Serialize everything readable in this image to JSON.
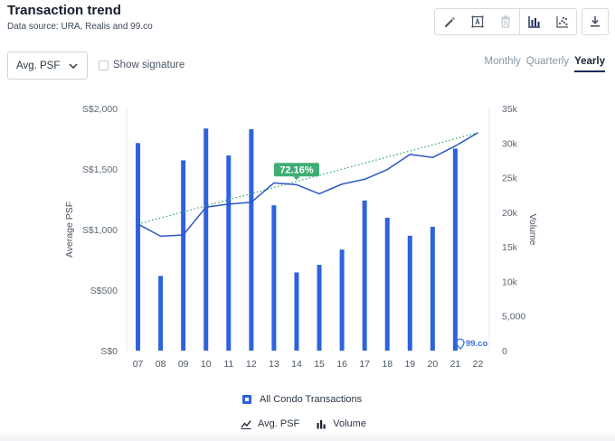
{
  "header": {
    "title": "Transaction trend",
    "subtitle": "Data source: URA, Realis and 99.co"
  },
  "toolbar": {
    "tools": [
      {
        "name": "pencil-icon",
        "enabled": true
      },
      {
        "name": "text-box-icon",
        "enabled": true
      },
      {
        "name": "trash-icon",
        "enabled": false
      },
      {
        "name": "bar-chart-icon",
        "enabled": true
      },
      {
        "name": "scatter-icon",
        "enabled": true
      }
    ],
    "download": {
      "name": "download-icon"
    }
  },
  "controls": {
    "metric_select": "Avg. PSF",
    "show_signature_label": "Show signature",
    "show_signature_checked": false,
    "periods": [
      "Monthly",
      "Quarterly",
      "Yearly"
    ],
    "active_period": "Yearly"
  },
  "colors": {
    "bar": "#2f62dd",
    "line": "#2b58c6",
    "trend": "#3aa76d",
    "badge": "#3fae74",
    "brand": "#3d6fe8"
  },
  "chart_data": {
    "type": "bar",
    "categories": [
      "07",
      "08",
      "09",
      "10",
      "11",
      "12",
      "13",
      "14",
      "15",
      "16",
      "17",
      "18",
      "19",
      "20",
      "21",
      "22"
    ],
    "y_left": {
      "label": "Average PSF",
      "min": 0,
      "max": 2000,
      "ticks": [
        "S$0",
        "S$500",
        "S$1,000",
        "S$1,500",
        "S$2,000"
      ],
      "tick_values": [
        0,
        500,
        1000,
        1500,
        2000
      ]
    },
    "y_right": {
      "label": "Volume",
      "min": 0,
      "max": 35000,
      "ticks": [
        "0",
        "5,000",
        "10k",
        "15k",
        "20k",
        "25k",
        "30k",
        "35k"
      ],
      "tick_values": [
        0,
        5000,
        10000,
        15000,
        20000,
        25000,
        30000,
        35000
      ]
    },
    "series": [
      {
        "name": "Volume",
        "kind": "bar",
        "axis": "right",
        "values": [
          30000,
          10800,
          27500,
          32100,
          28200,
          32000,
          21000,
          11300,
          12400,
          14600,
          21700,
          19200,
          16600,
          17900,
          29200,
          null
        ]
      },
      {
        "name": "Avg. PSF",
        "kind": "line",
        "axis": "left",
        "values": [
          1045,
          945,
          955,
          1185,
          1210,
          1225,
          1385,
          1370,
          1295,
          1375,
          1415,
          1495,
          1620,
          1595,
          1690,
          1800
        ]
      },
      {
        "name": "trend",
        "kind": "dotted",
        "axis": "left",
        "from": {
          "x": "07",
          "y": 1045
        },
        "to": {
          "x": "22",
          "y": 1800
        }
      }
    ],
    "annotation": {
      "text": "72.16%",
      "x": "14",
      "y": 1420
    },
    "legend": {
      "group": "All Condo Transactions",
      "items": [
        "Avg. PSF",
        "Volume"
      ]
    },
    "watermark": "99.co",
    "grid": false
  }
}
